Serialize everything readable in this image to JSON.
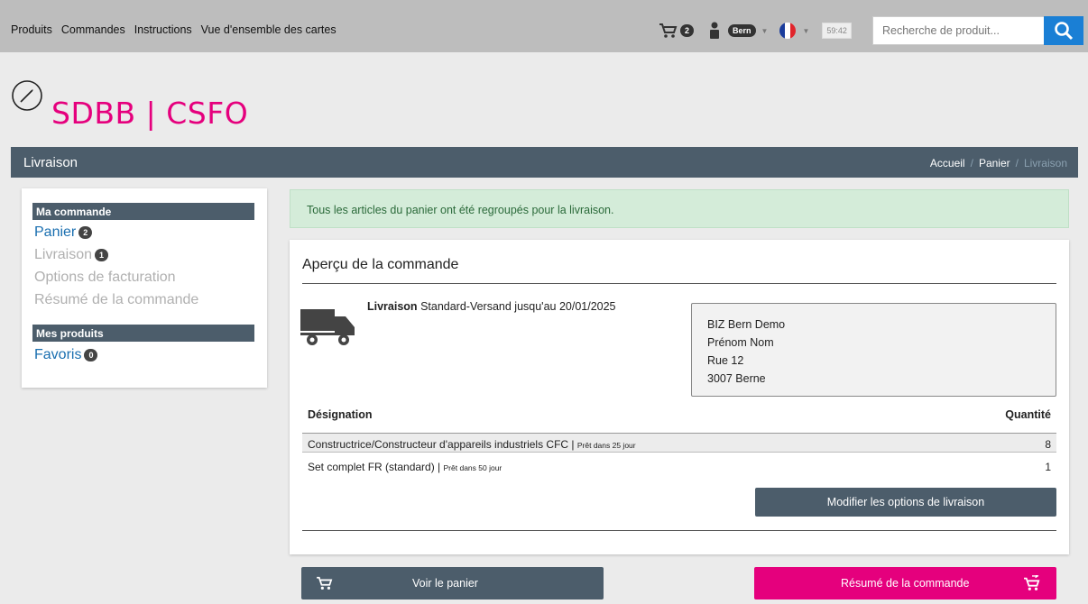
{
  "nav": [
    "Produits",
    "Commandes",
    "Instructions",
    "Vue d'ensemble des cartes"
  ],
  "topbar": {
    "cart_count": "2",
    "user": "Bern",
    "timer": "59:42",
    "search_placeholder": "Recherche de produit..."
  },
  "logo": {
    "text": "SDBB | CSFO"
  },
  "title": "Livraison",
  "breadcrumb": {
    "home": "Accueil",
    "sep": "/",
    "cart": "Panier",
    "current": "Livraison"
  },
  "sidebar": {
    "section1": "Ma commande",
    "panier": "Panier",
    "panier_count": "2",
    "livraison": "Livraison",
    "livraison_count": "1",
    "options": "Options de facturation",
    "resume": "Résumé de la commande",
    "section2": "Mes produits",
    "favoris": "Favoris",
    "favoris_count": "0"
  },
  "alert": "Tous les articles du panier ont été regroupés pour la livraison.",
  "card": {
    "title": "Aperçu de la commande",
    "delivery_label": "Livraison",
    "delivery_text": "Standard-Versand jusqu'au 20/01/2025",
    "address": [
      "BIZ Bern Demo",
      "Prénom Nom",
      "Rue 12",
      "3007 Berne"
    ],
    "col_designation": "Désignation",
    "col_quantity": "Quantité",
    "items": [
      {
        "name": "Constructrice/Constructeur d'appareils industriels CFC |",
        "ready": "Prêt dans 25 jour",
        "qty": "8"
      },
      {
        "name": "Set complet FR (standard) |",
        "ready": "Prêt dans 50 jour",
        "qty": "1"
      }
    ],
    "modify_button": "Modifier les options de livraison"
  },
  "buttons": {
    "view_cart": "Voir le panier",
    "summary": "Résumé de la commande"
  },
  "colors": {
    "accent": "#e5007d",
    "slate": "#4c5d6b",
    "blue": "#1a7fd5"
  }
}
